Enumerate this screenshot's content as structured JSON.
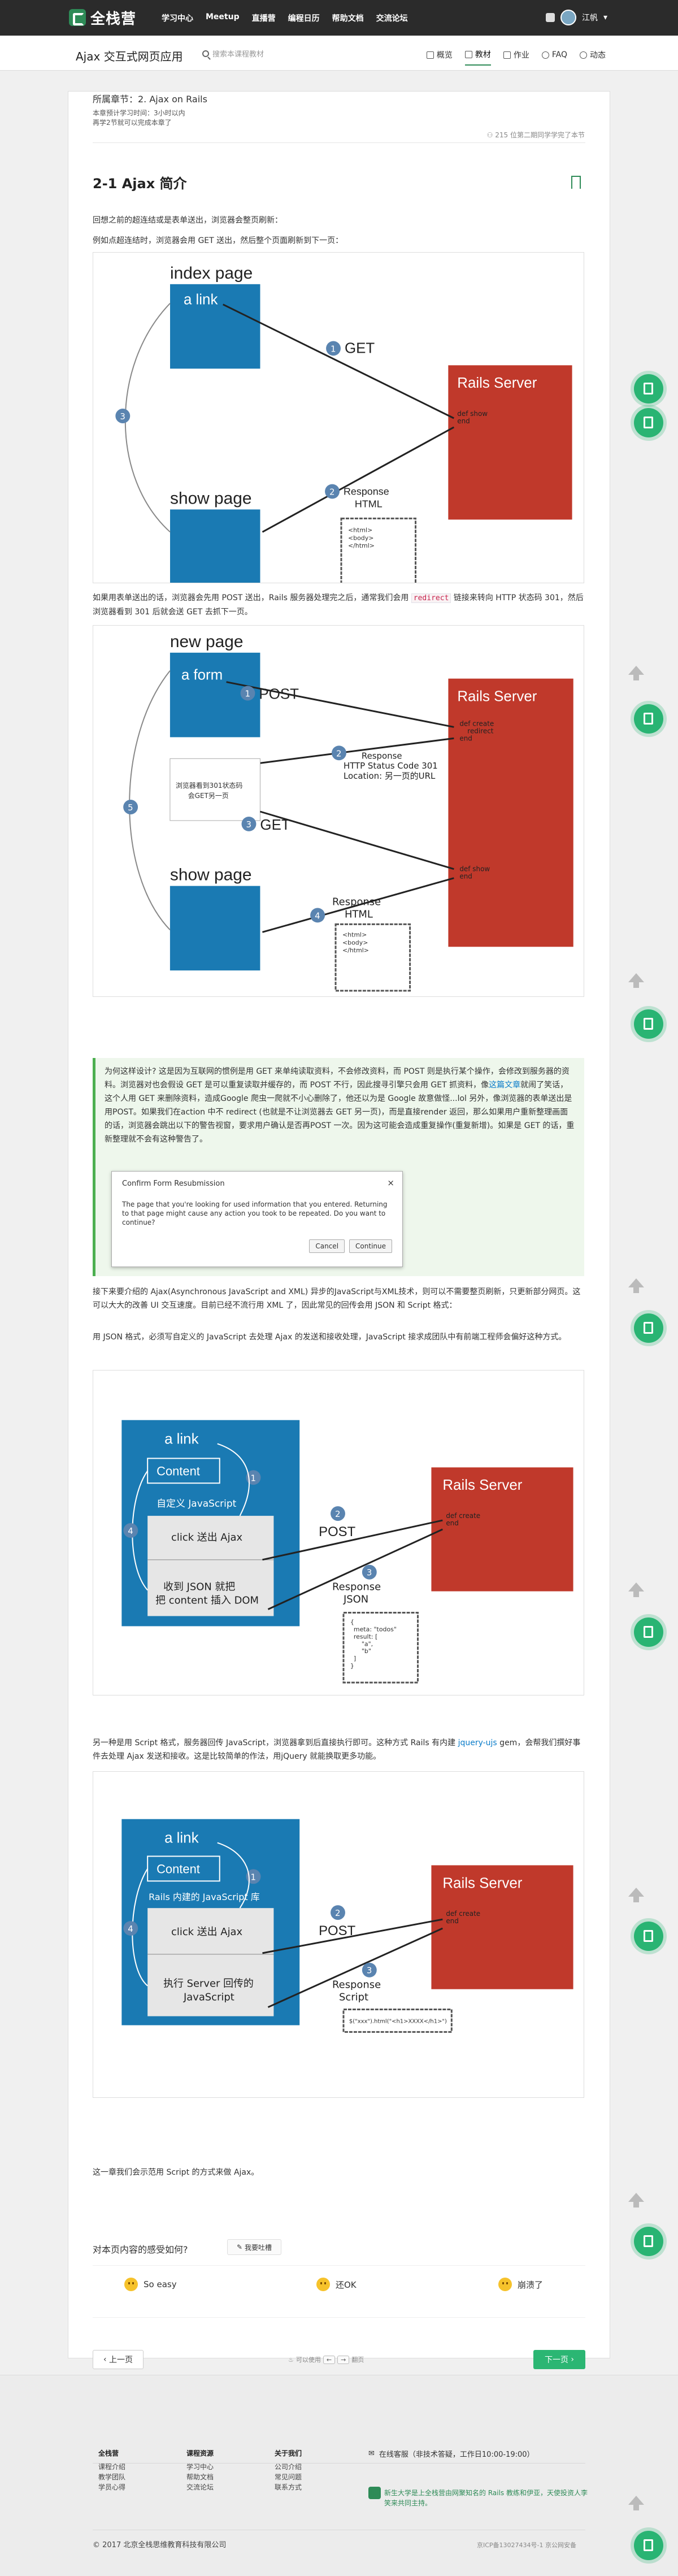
{
  "nav": {
    "brand": "全栈营",
    "links": [
      "学习中心",
      "Meetup",
      "直播营",
      "编程日历",
      "帮助文档",
      "交流论坛"
    ],
    "user": "江帆"
  },
  "subnav": {
    "course_title": "Ajax 交互式网页应用",
    "search_placeholder": "搜索本课程教材",
    "tabs": [
      "概览",
      "教材",
      "作业",
      "FAQ",
      "动态"
    ],
    "active_tab": "教材"
  },
  "chapter": {
    "title": "所属章节：2. Ajax on Rails",
    "est_time": "本章预计学习时间：3小时以内",
    "pace": "再学2节就可以完成本章了",
    "progress": "215 位第二期同学学完了本节"
  },
  "section": {
    "title": "2-1 Ajax 简介"
  },
  "paragraphs": {
    "p1": "回想之前的超连结或是表单送出，浏览器会整页刷新：",
    "p2": "例如点超连结时，浏览器会用 GET 送出，然后整个页面刷新到下一页：",
    "p3a": "如果用表单送出的话，浏览器会先用 POST 送出，Rails 服务器处理完之后，通常我们会用 ",
    "p3code": "redirect",
    "p3b": " 链接来转向 HTTP 状态码 301，然后浏览器看到 301 后就会送 GET 去抓下一页。",
    "p4": "接下来要介绍的 Ajax(Asynchronous JavaScript and XML) 异步的JavaScript与XML技术，则可以不需要整页刷新，只更新部分网页。这可以大大的改善 UI 交互速度。目前已经不流行用 XML 了，因此常见的回传会用 JSON 和 Script 格式：",
    "p5": "用 JSON 格式，必须写自定义的 JavaScript 去处理 Ajax 的发送和接收处理，JavaScript 接求成团队中有前端工程师会偏好这种方式。",
    "p6a": "另一种是用 Script 格式，服务器回传 JavaScript，浏览器拿到后直接执行即可。这种方式 Rails 有内建 ",
    "p6link": "jquery-ujs",
    "p6b": " gem，会帮我们撰好事件去处理 Ajax 发送和接收。这是比较简单的作法，用jQuery 就能换取更多功能。",
    "p7": "这一章我们会示范用 Script 的方式来做 Ajax。"
  },
  "figures": {
    "fig1": {
      "page1": "index page",
      "link": "a link",
      "step1": "GET",
      "server": "Rails Server",
      "server_code": [
        "def show",
        "end"
      ],
      "page2": "show page",
      "step2": "Response",
      "step2b": "HTML",
      "html_lines": [
        "<html>",
        "<body>",
        "</html>"
      ],
      "n1": "1",
      "n2": "2",
      "n3": "3"
    },
    "fig2": {
      "page1": "new page",
      "form": "a form",
      "step1": "POST",
      "server": "Rails Server",
      "server_code1": [
        "def create",
        "redirect",
        "end"
      ],
      "server_code2": [
        "def show",
        "end"
      ],
      "resp1": "Response",
      "resp1b": "HTTP Status Code 301",
      "resp1c": "Location: 另一页的URL",
      "browser_note": [
        "浏览器看到301状态码",
        "会GET另一页"
      ],
      "step3": "GET",
      "page2": "show page",
      "resp2": "Response",
      "resp2b": "HTML",
      "html_lines": [
        "<html>",
        "<body>",
        "</html>"
      ],
      "n1": "1",
      "n2": "2",
      "n3": "3",
      "n4": "4",
      "n5": "5"
    },
    "fig3": {
      "link": "a link",
      "content": "Content",
      "custom_js": "自定义 JavaScript",
      "click": "click 送出 Ajax",
      "recv": [
        "收到 JSON 就把",
        "把 content 插入 DOM"
      ],
      "step2": "POST",
      "server": "Rails Server",
      "server_code": [
        "def create",
        "end"
      ],
      "resp": "Response",
      "resp_b": "JSON",
      "json_lines": [
        "{",
        "meta: \"todos\"",
        "result: [",
        "\"a\",",
        "\"b\"",
        "]",
        "}"
      ],
      "n1": "1",
      "n2": "2",
      "n3": "3",
      "n4": "4"
    },
    "fig4": {
      "link": "a link",
      "content": "Content",
      "builtin_js": "Rails 内建的 JavaScript 库",
      "click": "click 送出 Ajax",
      "exec": [
        "执行 Server 回传的",
        "JavaScript"
      ],
      "step2": "POST",
      "server": "Rails Server",
      "server_code": [
        "def create",
        "end"
      ],
      "resp": "Response",
      "resp_b": "Script",
      "script_line": "$(\"xxx\").html(\"<h1>XXXX</h1>\")",
      "n1": "1",
      "n2": "2",
      "n3": "3",
      "n4": "4"
    }
  },
  "note": {
    "text_a": "为何这样设计? 这是因为互联网的惯例是用 GET 来单纯读取资料，不会修改资料，而 POST 则是执行某个操作，会修改到服务器的资料。浏览器对也会假设 GET 是可以重复读取并缓存的，而 POST 不行，因此搜寻引擎只会用 GET 抓资料，像",
    "text_link": "这篇文章",
    "text_b": "就闹了笑话，这个人用 GET 来删除资料，造成Google 爬虫一爬就不小心删除了，他还以为是 Google 故意做怪...lol 另外，像浏览器的表单送出是用POST。如果我们在action 中不 redirect (也就是不让浏览器去 GET 另一页)，而是直接render 返回，那么如果用户重新整理画面的话，浏览器会跳出以下的警告视窗，要求用户确认是否再POST 一次。因为这可能会造成重复操作(重复新增)。如果是 GET 的话，重新整理就不会有这种警告了。",
    "dialog_title": "Confirm Form Resubmission",
    "dialog_body": "The page that you're looking for used information that you entered. Returning to that page might cause any action you took to be repeated. Do you want to continue?",
    "dialog_cancel": "Cancel",
    "dialog_continue": "Continue",
    "dialog_close": "×"
  },
  "feedback": {
    "question": "对本页内容的感受如何?",
    "button": "我要吐槽",
    "options": [
      "So easy",
      "还OK",
      "崩溃了"
    ]
  },
  "pager": {
    "prev": "上一页",
    "next": "下一页",
    "hint": "可以使用",
    "key_left": "←",
    "key_right": "→",
    "hint_tail": "翻页"
  },
  "footer": {
    "col1": {
      "title": "全栈营",
      "items": [
        "课程介绍",
        "教学团队",
        "学员心得"
      ]
    },
    "col2": {
      "title": "课程资源",
      "items": [
        "学习中心",
        "帮助文档",
        "交流论坛"
      ]
    },
    "col3": {
      "title": "关于我们",
      "items": [
        "公司介绍",
        "常见问题",
        "联系方式"
      ]
    },
    "service": "在线客服（非技术答疑，工作日10:00-19:00）",
    "about": "新生大学是上全栈营由网聚知名的 Rails 教练和伊亚，天使投资人李笑来共同主持。",
    "copyright": "© 2017 北京全栈思维教育科技有限公司",
    "icp": "京ICP备13027434号-1 京公网安备"
  }
}
